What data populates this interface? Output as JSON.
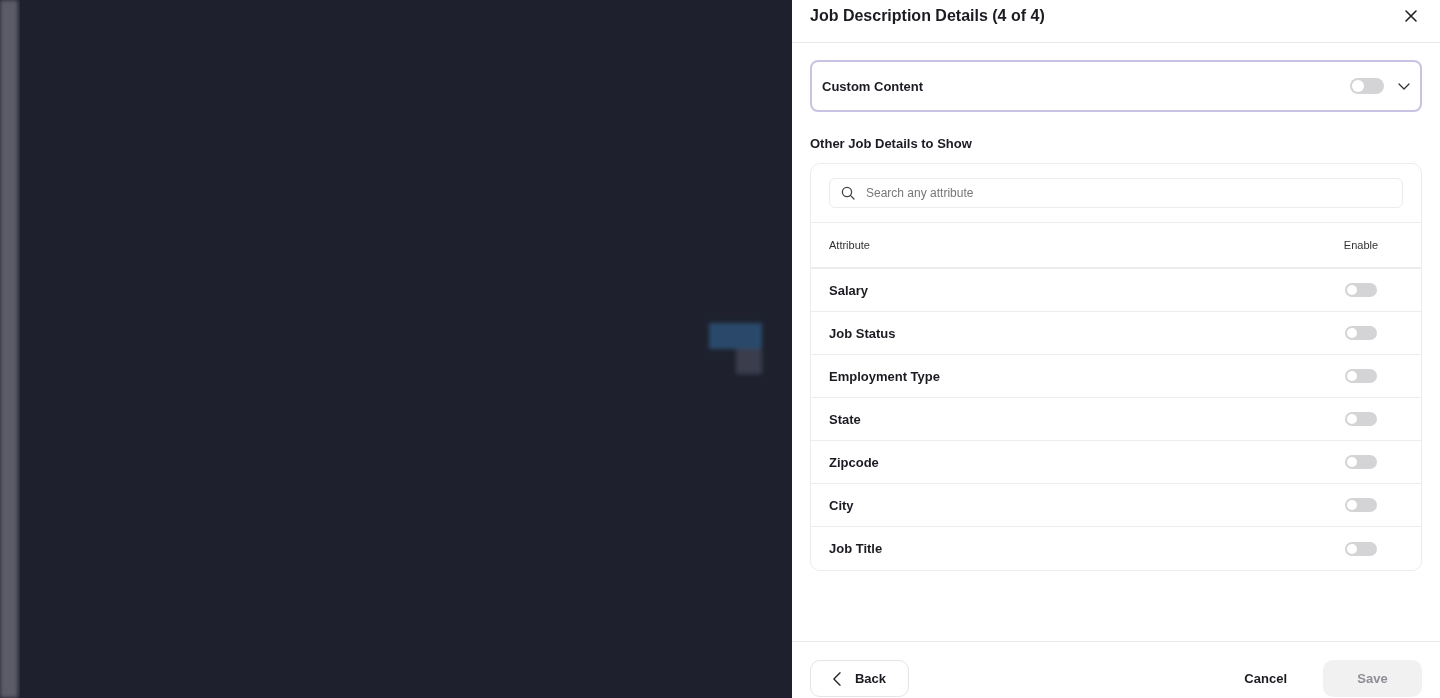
{
  "title": "Job Description Details (4 of 4)",
  "custom_content": {
    "label": "Custom Content",
    "on": false,
    "expanded": false
  },
  "section_title": "Other Job Details to Show",
  "search": {
    "placeholder": "Search any attribute"
  },
  "table": {
    "columns": [
      "Attribute",
      "Enable"
    ],
    "rows": [
      {
        "attribute": "Salary",
        "enabled": false
      },
      {
        "attribute": "Job Status",
        "enabled": false
      },
      {
        "attribute": "Employment Type",
        "enabled": false
      },
      {
        "attribute": "State",
        "enabled": false
      },
      {
        "attribute": "Zipcode",
        "enabled": false
      },
      {
        "attribute": "City",
        "enabled": false
      },
      {
        "attribute": "Job Title",
        "enabled": false
      }
    ]
  },
  "footer": {
    "back": "Back",
    "cancel": "Cancel",
    "save": {
      "label": "Save",
      "disabled": true
    }
  }
}
